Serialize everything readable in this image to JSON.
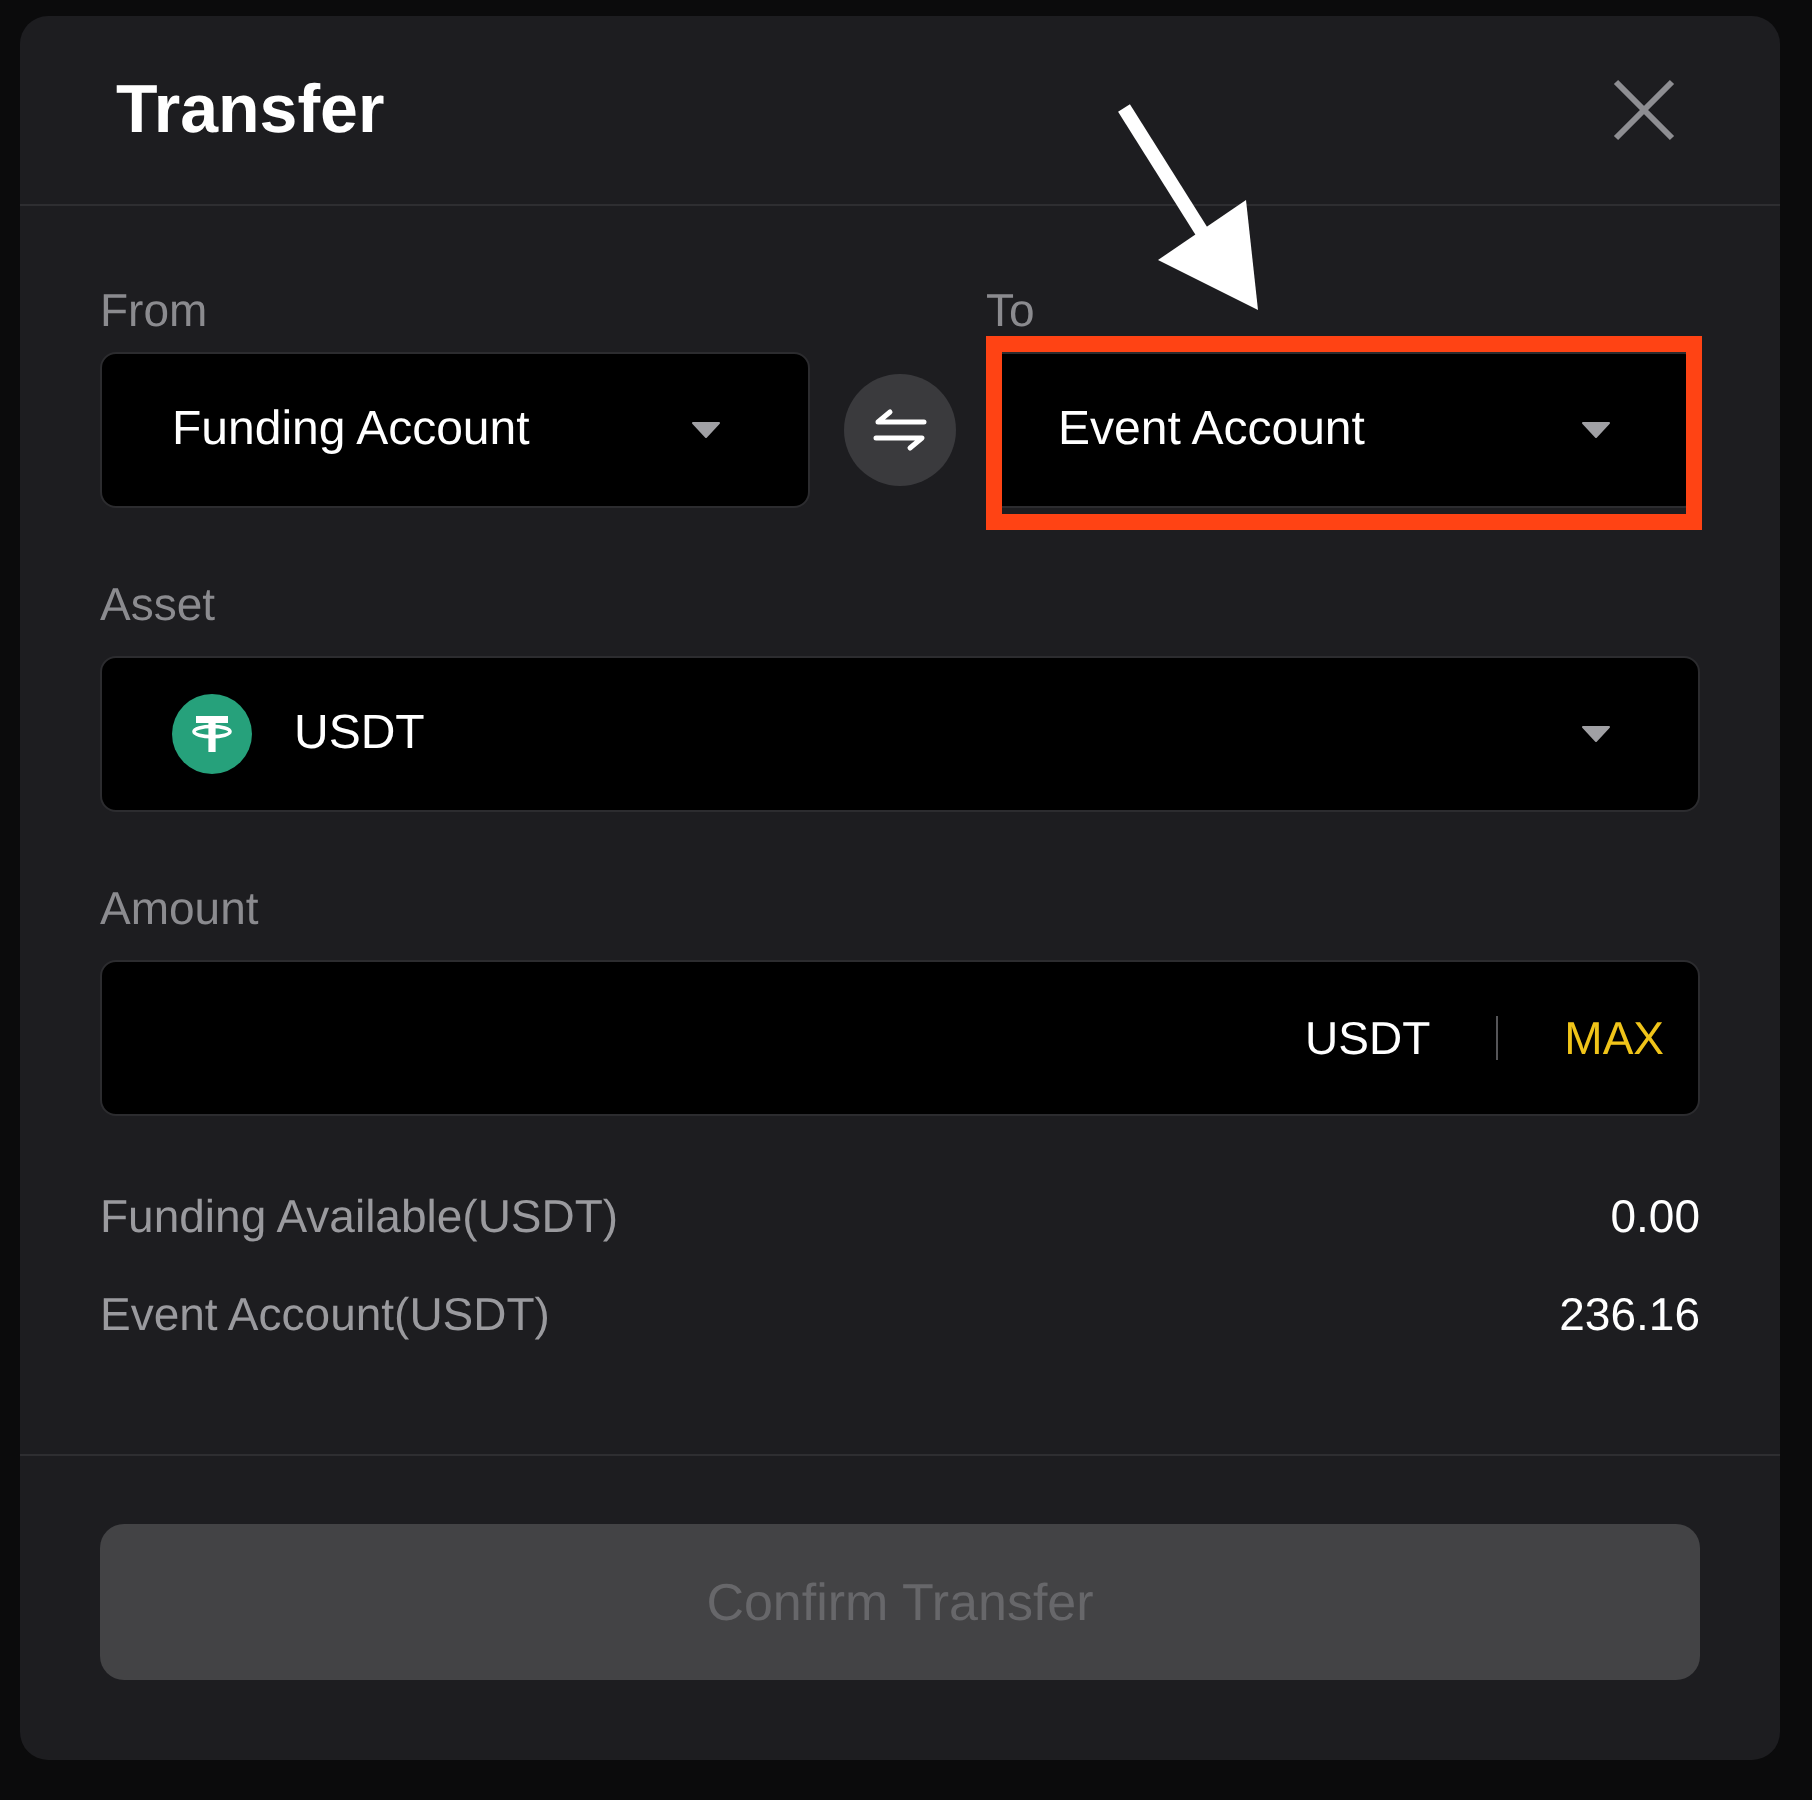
{
  "dialog": {
    "title": "Transfer"
  },
  "account_fields": [
    {
      "label": "From",
      "value": "Funding Account",
      "highlighted": false
    },
    {
      "label": "To",
      "value": "Event Account",
      "highlighted": true
    }
  ],
  "asset": {
    "label": "Asset",
    "value": "USDT"
  },
  "amount": {
    "label": "Amount",
    "unit": "USDT",
    "max_label": "MAX"
  },
  "balances": [
    {
      "label": "Funding Available(USDT)",
      "value": "0.00"
    },
    {
      "label": "Event Account(USDT)",
      "value": "236.16"
    }
  ],
  "confirm_button": {
    "label": "Confirm Transfer",
    "disabled": true
  }
}
